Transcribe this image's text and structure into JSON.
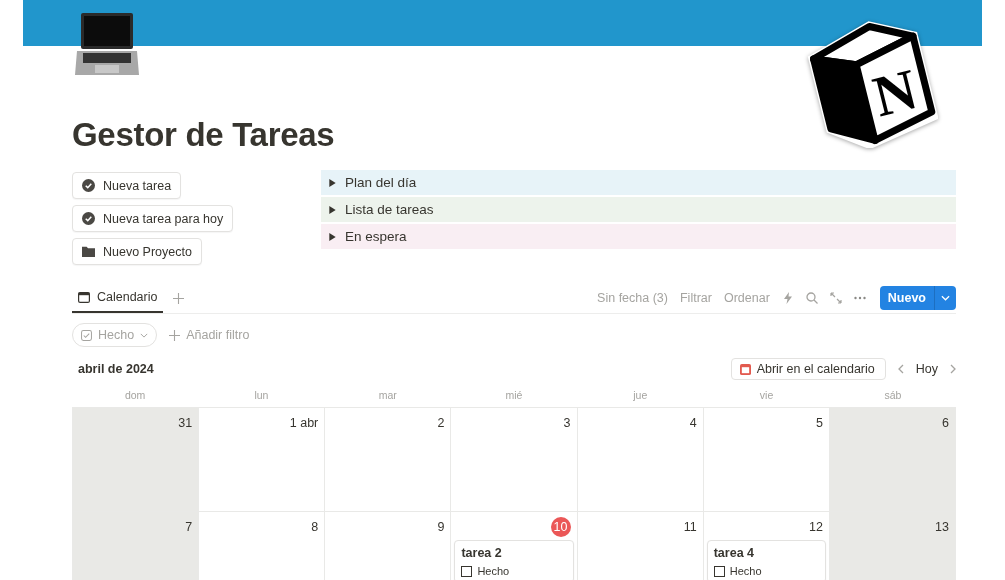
{
  "logo": {
    "letter": "N"
  },
  "title": "Gestor de Tareas",
  "action_buttons": [
    {
      "label": "Nueva tarea",
      "kind": "check"
    },
    {
      "label": "Nueva tarea para hoy",
      "kind": "check"
    },
    {
      "label": "Nuevo Proyecto",
      "kind": "folder"
    }
  ],
  "toggles": [
    {
      "label": "Plan del día",
      "color": "#e7f3f8"
    },
    {
      "label": "Lista de tareas",
      "color": "#edf3ec"
    },
    {
      "label": "En espera",
      "color": "#f9eef3"
    }
  ],
  "view_tabs": [
    {
      "label": "Calendario",
      "selected": true
    }
  ],
  "toolbar": {
    "no_date": "Sin fecha (3)",
    "filter": "Filtrar",
    "sort": "Ordenar",
    "new_button": "Nuevo"
  },
  "filters": [
    {
      "label": "Hecho"
    }
  ],
  "add_filter": "Añadir filtro",
  "calendar": {
    "month": "abril de 2024",
    "open_in_calendar": "Abrir en el calendario",
    "today_button": "Hoy",
    "weekdays": [
      "dom",
      "lun",
      "mar",
      "mié",
      "jue",
      "vie",
      "sáb"
    ],
    "weeks": [
      [
        {
          "day": "31",
          "shaded": true,
          "today": false
        },
        {
          "day": "1 abr",
          "shaded": false,
          "today": false
        },
        {
          "day": "2",
          "shaded": false,
          "today": false
        },
        {
          "day": "3",
          "shaded": false,
          "today": false
        },
        {
          "day": "4",
          "shaded": false,
          "today": false
        },
        {
          "day": "5",
          "shaded": false,
          "today": false
        },
        {
          "day": "6",
          "shaded": true,
          "today": false
        }
      ],
      [
        {
          "day": "7",
          "shaded": true,
          "today": false
        },
        {
          "day": "8",
          "shaded": false,
          "today": false
        },
        {
          "day": "9",
          "shaded": false,
          "today": false
        },
        {
          "day": "10",
          "shaded": false,
          "today": true,
          "events": [
            {
              "title": "tarea 2",
              "property": "Hecho",
              "checked": false
            }
          ]
        },
        {
          "day": "11",
          "shaded": false,
          "today": false
        },
        {
          "day": "12",
          "shaded": false,
          "today": false,
          "events": [
            {
              "title": "tarea 4",
              "property": "Hecho",
              "checked": false
            }
          ]
        },
        {
          "day": "13",
          "shaded": true,
          "today": false
        }
      ]
    ]
  }
}
